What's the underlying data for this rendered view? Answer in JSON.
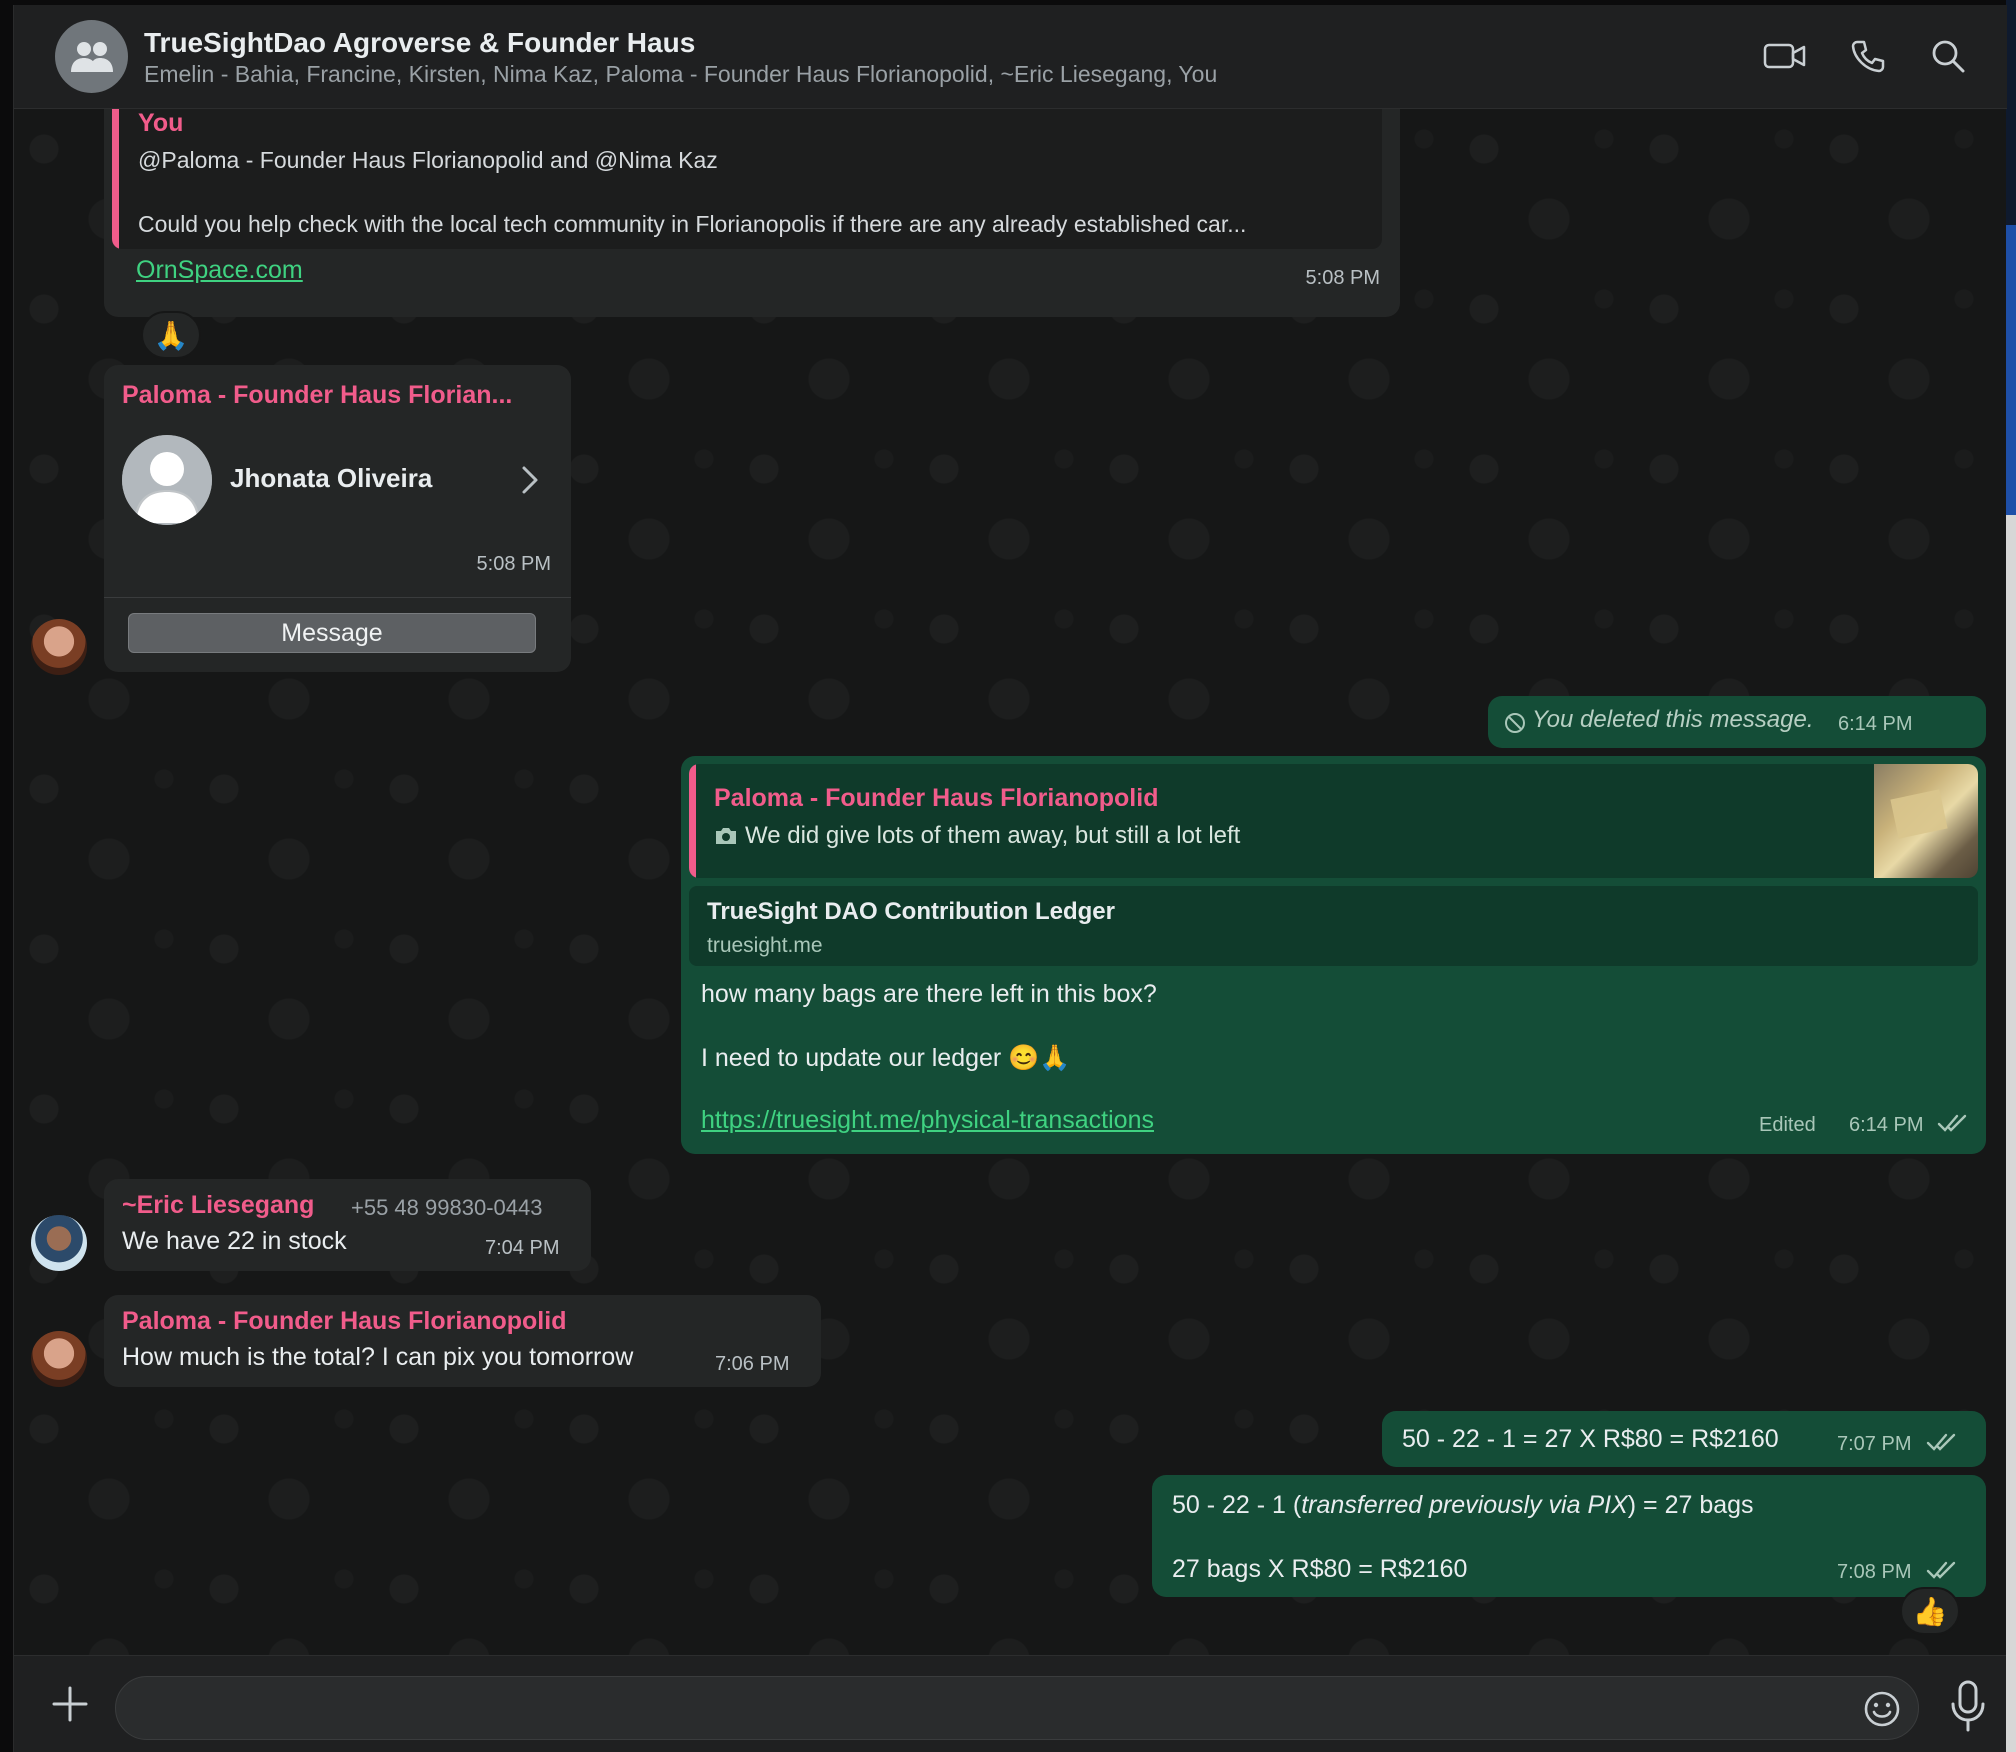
{
  "header": {
    "title": "TrueSightDao Agroverse & Founder Haus",
    "members": "Emelin - Bahia, Francine, Kirsten, Nima Kaz, Paloma - Founder Haus Florianopolid, ~Eric Liesegang, You",
    "icons": [
      "group-avatar-icon",
      "video-call-icon",
      "voice-call-icon",
      "search-icon"
    ]
  },
  "messages": {
    "m1": {
      "quote_author": "You",
      "quote_line1": "@Paloma - Founder Haus Florianopolid and @Nima Kaz",
      "quote_line2": "Could you help check with the local tech community in Florianopolis if there are any already established car...",
      "link": "OrnSpace.com",
      "time": "5:08 PM",
      "reaction": "🙏"
    },
    "m2": {
      "sender": "Paloma - Founder Haus Florian...",
      "contact_name": "Jhonata Oliveira",
      "time": "5:08 PM",
      "button": "Message"
    },
    "m3": {
      "text": "You deleted this message.",
      "time": "6:14 PM"
    },
    "m4": {
      "quote_author": "Paloma - Founder Haus Florianopolid",
      "quote_text": "We did give lots of them away, but still a lot left",
      "preview_title": "TrueSight DAO Contribution Ledger",
      "preview_domain": "truesight.me",
      "line1": "how many bags are there left in this box?",
      "line2": "I need to update our ledger 😊🙏",
      "link": "https://truesight.me/physical-transactions",
      "edited": "Edited",
      "time": "6:14 PM"
    },
    "m5": {
      "sender": "~Eric Liesegang",
      "phone": "+55 48 99830-0443",
      "text": "We have 22 in stock",
      "time": "7:04 PM"
    },
    "m6": {
      "sender": "Paloma - Founder Haus Florianopolid",
      "text": "How much is the total? I can pix you tomorrow",
      "time": "7:06 PM"
    },
    "m7": {
      "text": "50 - 22 - 1 = 27 X R$80 = R$2160",
      "time": "7:07 PM"
    },
    "m8": {
      "line1_a": "50 - 22 - 1 (",
      "line1_italic": "transferred previously via PIX",
      "line1_b": ") = 27 bags",
      "line2": "27 bags X R$80 = R$2160",
      "time": "7:08 PM",
      "reaction": "👍"
    }
  },
  "composer": {
    "placeholder": "",
    "icons": [
      "plus-icon",
      "emoji-icon",
      "microphone-icon"
    ]
  },
  "colors": {
    "incoming_bubble": "#242626",
    "outgoing_bubble": "#144d37",
    "sender_name": "#f15c8b",
    "link": "#3fd281"
  }
}
